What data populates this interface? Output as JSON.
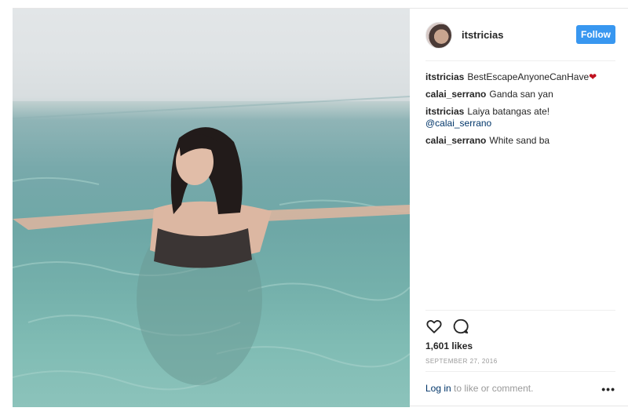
{
  "post": {
    "username": "itstricias",
    "follow_label": "Follow",
    "comments": [
      {
        "user": "itstricias",
        "text": "BestEscapeAnyoneCanHave",
        "emoji": "❤"
      },
      {
        "user": "calai_serrano",
        "text": "Ganda san yan"
      },
      {
        "user": "itstricias",
        "text": "Laiya batangas ate!",
        "mention": "@calai_serrano"
      },
      {
        "user": "calai_serrano",
        "text": "White sand ba"
      }
    ],
    "likes": "1,601 likes",
    "date": "SEPTEMBER 27, 2016",
    "login_link": "Log in",
    "login_suffix": " to like or comment.",
    "more_glyph": "•••"
  },
  "colors": {
    "accent": "#3897f0",
    "link": "#003569",
    "heart": "#c0111f"
  },
  "icons": [
    "heart-icon",
    "comment-icon",
    "more-options-icon"
  ]
}
